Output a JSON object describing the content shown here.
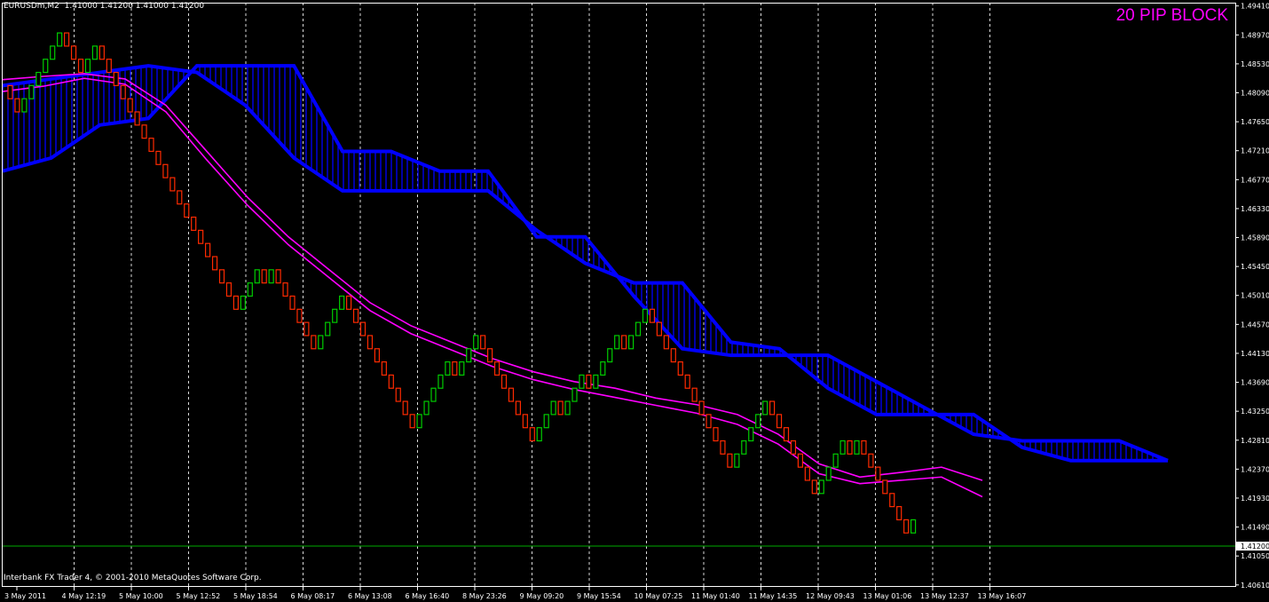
{
  "header": {
    "symbol_timeframe": "EURUSDm,M2",
    "ohlc": "1.41000 1.41200 1.41000 1.41200"
  },
  "overlay_label": "20 PIP BLOCK",
  "footer": "Interbank FX Trader 4, © 2001-2010 MetaQuotes Software Corp.",
  "colors": {
    "background": "#000000",
    "bull": "#00cc00",
    "bear": "#ff2a00",
    "cloud": "#0000ff",
    "ma": "#ff00ff",
    "bid_line": "#00aa00",
    "grid": "#ffffff"
  },
  "chart_data": {
    "type": "renko-candles",
    "price_labels": [
      "1.49410",
      "1.48970",
      "1.48530",
      "1.48090",
      "1.47650",
      "1.47210",
      "1.46770",
      "1.46330",
      "1.45890",
      "1.45450",
      "1.45010",
      "1.44570",
      "1.44130",
      "1.43690",
      "1.43250",
      "1.42810",
      "1.42370",
      "1.41930",
      "1.41490",
      "1.41050",
      "1.40610"
    ],
    "current_price": "1.41200",
    "time_labels": [
      "3 May 2011",
      "4 May 12:19",
      "5 May 10:00",
      "5 May 12:52",
      "5 May 18:54",
      "6 May 08:17",
      "6 May 13:08",
      "6 May 16:40",
      "8 May 23:26",
      "9 May 09:20",
      "9 May 15:54",
      "10 May 07:25",
      "11 May 01:40",
      "11 May 14:35",
      "12 May 09:43",
      "13 May 01:06",
      "13 May 12:37",
      "13 May 16:07"
    ],
    "brick_size": 0.002,
    "ylim": [
      1.4058,
      1.4946
    ],
    "start_price": 1.482,
    "directions": [
      -1,
      -1,
      1,
      1,
      1,
      1,
      1,
      1,
      -1,
      -1,
      -1,
      1,
      1,
      -1,
      -1,
      -1,
      -1,
      -1,
      -1,
      -1,
      -1,
      -1,
      -1,
      -1,
      -1,
      -1,
      -1,
      -1,
      -1,
      -1,
      -1,
      -1,
      -1,
      1,
      1,
      1,
      -1,
      1,
      -1,
      -1,
      -1,
      -1,
      -1,
      -1,
      1,
      1,
      1,
      1,
      -1,
      -1,
      -1,
      -1,
      -1,
      -1,
      -1,
      -1,
      -1,
      -1,
      1,
      1,
      1,
      1,
      1,
      -1,
      1,
      1,
      1,
      -1,
      -1,
      -1,
      -1,
      -1,
      -1,
      -1,
      -1,
      1,
      1,
      1,
      -1,
      1,
      1,
      1,
      -1,
      1,
      1,
      1,
      1,
      -1,
      1,
      1,
      1,
      -1,
      -1,
      -1,
      -1,
      -1,
      -1,
      -1,
      -1,
      -1,
      -1,
      -1,
      -1,
      1,
      1,
      1,
      1,
      1,
      -1,
      -1,
      -1,
      -1,
      -1,
      -1,
      -1,
      1,
      1,
      1,
      1,
      -1,
      1,
      -1,
      -1,
      -1,
      -1,
      -1,
      -1,
      -1,
      1
    ],
    "cloud_span_a": [
      1.482,
      1.483,
      1.484,
      1.485,
      1.484,
      1.479,
      1.471,
      1.466,
      1.466,
      1.466,
      1.466,
      1.46,
      1.455,
      1.452,
      1.452,
      1.443,
      1.442,
      1.436,
      1.432,
      1.432,
      1.432,
      1.427,
      1.425,
      1.425,
      1.425
    ],
    "cloud_span_b": [
      1.469,
      1.471,
      1.476,
      1.477,
      1.485,
      1.485,
      1.485,
      1.472,
      1.472,
      1.469,
      1.469,
      1.459,
      1.459,
      1.45,
      1.442,
      1.441,
      1.441,
      1.441,
      1.437,
      1.433,
      1.429,
      1.428,
      1.428,
      1.428,
      1.425
    ],
    "ma_fast": [
      1.4829,
      1.4834,
      1.4838,
      1.483,
      1.479,
      1.472,
      1.465,
      1.459,
      1.454,
      1.449,
      1.4455,
      1.443,
      1.4405,
      1.4385,
      1.437,
      1.436,
      1.4345,
      1.4335,
      1.432,
      1.429,
      1.4245,
      1.4225,
      1.4232,
      1.424,
      1.422
    ],
    "ma_slow": [
      1.4811,
      1.4819,
      1.4831,
      1.4822,
      1.478,
      1.4707,
      1.4638,
      1.4578,
      1.4528,
      1.4478,
      1.4443,
      1.4418,
      1.4393,
      1.4373,
      1.4358,
      1.4346,
      1.4334,
      1.4322,
      1.4305,
      1.4275,
      1.423,
      1.4215,
      1.422,
      1.4225,
      1.4195
    ]
  }
}
